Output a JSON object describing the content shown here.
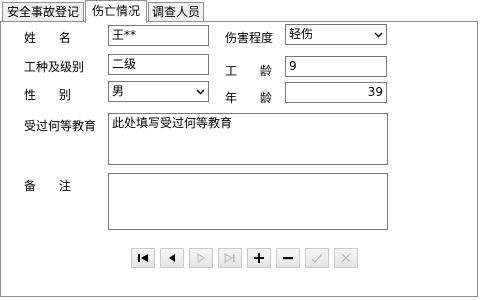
{
  "tabs": [
    {
      "label": "安全事故登记"
    },
    {
      "label": "伤亡情况"
    },
    {
      "label": "调查人员"
    }
  ],
  "form": {
    "name_label": "姓      名",
    "name_value": "王**",
    "injury_label": "伤害程度",
    "injury_value": "轻伤",
    "job_label": "工种及级别",
    "job_value": "二级",
    "seniority_label": "工      龄",
    "seniority_value": "9",
    "gender_label": "性      别",
    "gender_value": "男",
    "age_label": "年      龄",
    "age_value": "39",
    "education_label": "受过何等教育",
    "education_value": "此处填写受过何等教育",
    "remarks_label": "备      注",
    "remarks_value": ""
  },
  "navigator": {
    "buttons": [
      {
        "icon": "first-record-icon",
        "enabled": true
      },
      {
        "icon": "prior-record-icon",
        "enabled": true
      },
      {
        "icon": "next-record-icon",
        "enabled": false
      },
      {
        "icon": "last-record-icon",
        "enabled": false
      },
      {
        "icon": "insert-record-icon",
        "enabled": true
      },
      {
        "icon": "delete-record-icon",
        "enabled": true
      },
      {
        "icon": "post-edit-icon",
        "enabled": false
      },
      {
        "icon": "cancel-edit-icon",
        "enabled": false
      }
    ]
  }
}
